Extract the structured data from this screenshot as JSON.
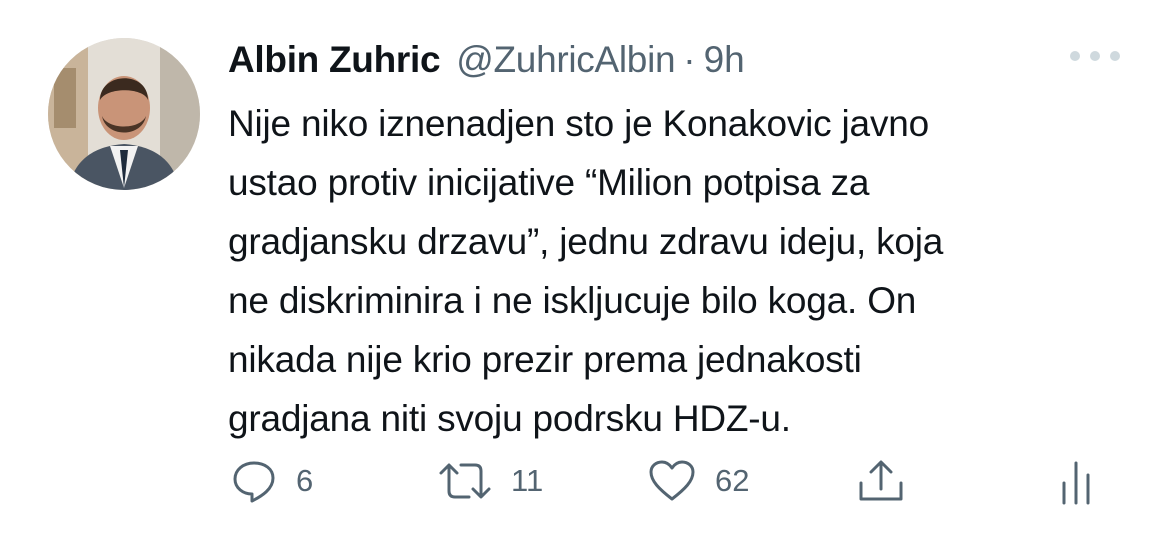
{
  "tweet": {
    "author_name": "Albin Zuhric",
    "handle": "@ZuhricAlbin",
    "separator": "·",
    "time": "9h",
    "text": "Nije niko iznenadjen sto je Konakovic javno\nustao protiv inicijative “Milion potpisa za\ngradjansku drzavu”, jednu zdravu ideju, koja\nne diskriminira  i ne iskljucuje bilo koga. On\nnikada nije krio prezir prema jednakosti\ngradjana niti svoju podrsku HDZ-u."
  },
  "actions": {
    "reply_icon": "reply-bubble-icon",
    "reply_count": "6",
    "retweet_icon": "retweet-icon",
    "retweet_count": "11",
    "like_icon": "heart-icon",
    "like_count": "62",
    "share_icon": "share-upload-icon",
    "analytics_icon": "analytics-bars-icon"
  },
  "colors": {
    "text": "#0f1419",
    "secondary": "#536471",
    "more_dots": "#cfd9de"
  }
}
